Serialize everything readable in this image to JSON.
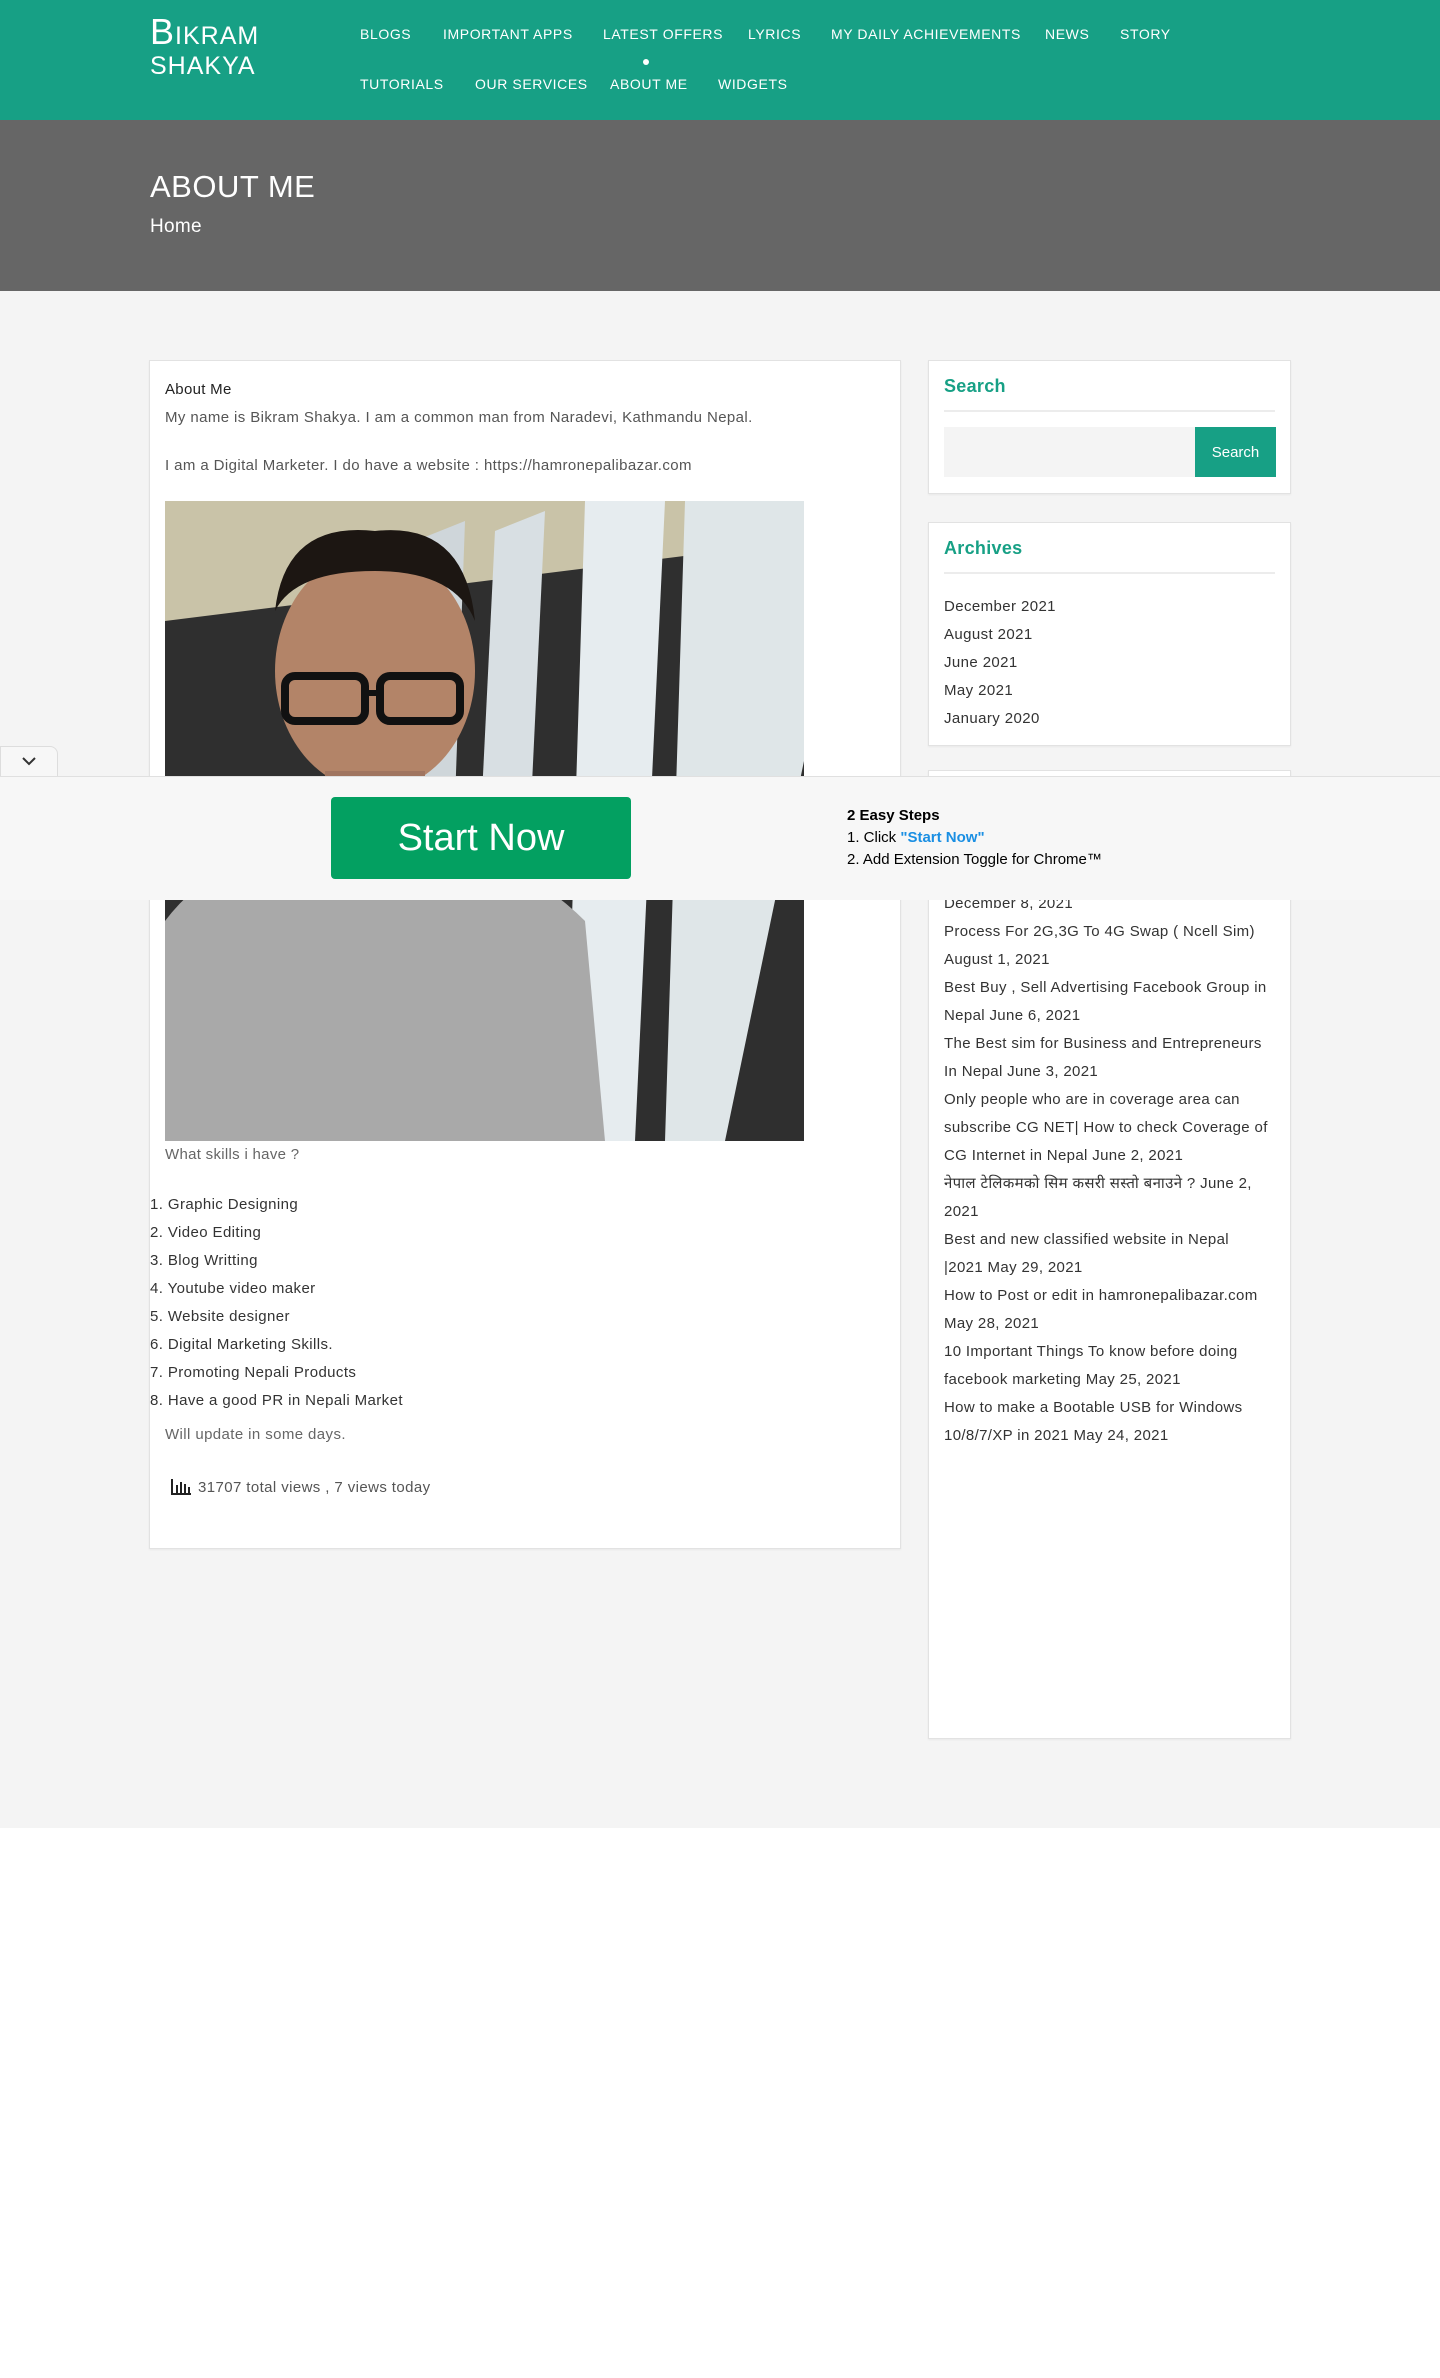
{
  "header": {
    "logo_line1_initial": "B",
    "logo_line1_rest": "IKRAM",
    "logo_line2": "SHAKYA",
    "nav_row1": [
      "BLOGS",
      "IMPORTANT APPS",
      "LATEST OFFERS",
      "LYRICS",
      "MY DAILY ACHIEVEMENTS",
      "NEWS",
      "STORY"
    ],
    "nav_row2": [
      "TUTORIALS",
      "OUR SERVICES",
      "ABOUT ME",
      "WIDGETS"
    ],
    "active_item": "ABOUT ME",
    "accent_color": "#17a085"
  },
  "banner": {
    "title": "ABOUT ME",
    "breadcrumb": "Home",
    "background": "#666666"
  },
  "main": {
    "heading": "About Me",
    "para1": "My name is Bikram Shakya. I am a common man from Naradevi, Kathmandu Nepal.",
    "para2": "I am a Digital Marketer. I do have a website : https://hamronepalibazar.com",
    "photo_caption": "What skills i have ?",
    "skills": [
      "1. Graphic Designing",
      "2. Video Editing",
      "3. Blog Writting",
      "4. Youtube video maker",
      "5. Website designer",
      "6. Digital Marketing Skills.",
      "7. Promoting Nepali Products",
      "8. Have a good PR in Nepali Market"
    ],
    "update_note": "Will update in some days.",
    "views_text": "31707 total views , 7 views today"
  },
  "sidebar": {
    "search": {
      "title": "Search",
      "button_label": "Search",
      "placeholder": ""
    },
    "archives": {
      "title": "Archives",
      "items": [
        "December 2021",
        "August 2021",
        "June 2021",
        "May 2021",
        "January 2020"
      ]
    },
    "recent": {
      "lines": [
        "December 8, 2021",
        "Process For 2G,3G To 4G Swap ( Ncell Sim)",
        "August 1, 2021",
        "Best Buy , Sell Advertising Facebook Group in",
        "Nepal June 6, 2021",
        "The Best sim for Business and Entrepreneurs",
        "In Nepal June 3, 2021",
        "Only people who are in coverage area can",
        "subscribe CG NET| How to check Coverage of",
        "CG Internet in Nepal June 2, 2021",
        "नेपाल टेलिकमको सिम कसरी सस्तो बनाउने ? June 2,",
        "2021",
        "Best and new classified website in Nepal",
        "|2021 May 29, 2021",
        "How to Post or edit in hamronepalibazar.com",
        "May 28, 2021",
        "10 Important Things To know before doing",
        "facebook marketing May 25, 2021",
        "How to make a Bootable USB for Windows",
        "10/8/7/XP in 2021 May 24, 2021"
      ]
    }
  },
  "ad": {
    "button_label": "Start Now",
    "steps_title": "2 Easy Steps",
    "step1_prefix": "1. Click ",
    "step1_link": "\"Start Now\"",
    "step2": "2. Add Extension Toggle for Chrome™",
    "button_color": "#03a061"
  }
}
